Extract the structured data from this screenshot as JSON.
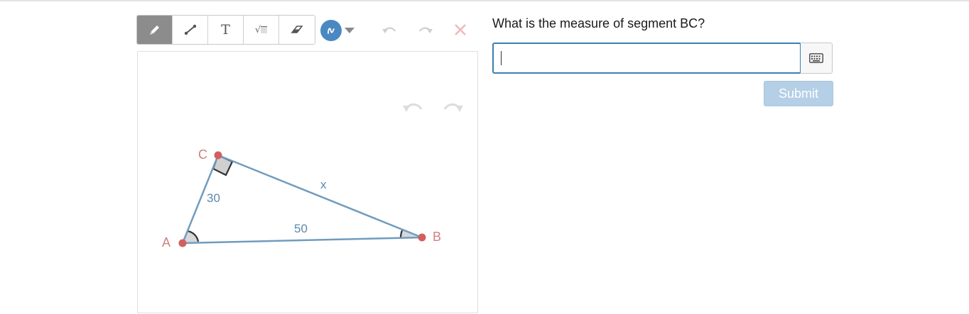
{
  "toolbar": {
    "tools": [
      {
        "name": "pencil",
        "icon": "pencil-icon",
        "active": true
      },
      {
        "name": "line",
        "icon": "line-segment-icon",
        "active": false
      },
      {
        "name": "text",
        "icon": "text-icon",
        "label": "T",
        "active": false
      },
      {
        "name": "math",
        "icon": "sqrt-icon",
        "label": "√",
        "active": false
      },
      {
        "name": "eraser",
        "icon": "eraser-icon",
        "active": false
      }
    ],
    "color": "#4a88c2",
    "actions": [
      "undo-icon",
      "redo-icon",
      "close-icon"
    ]
  },
  "canvas": {
    "actions": [
      "undo-icon",
      "redo-icon"
    ],
    "triangle": {
      "vertices": {
        "A": "A",
        "B": "B",
        "C": "C"
      },
      "side_ac": "30",
      "side_ab": "50",
      "side_bc": "x"
    }
  },
  "question": {
    "text": "What is the measure of segment BC?",
    "answer_value": "",
    "submit_label": "Submit"
  },
  "colors": {
    "accent": "#3b7fb0",
    "vertex": "#d25f5f",
    "edge": "#6f9cc0",
    "submit_disabled": "#b4cfe6"
  }
}
